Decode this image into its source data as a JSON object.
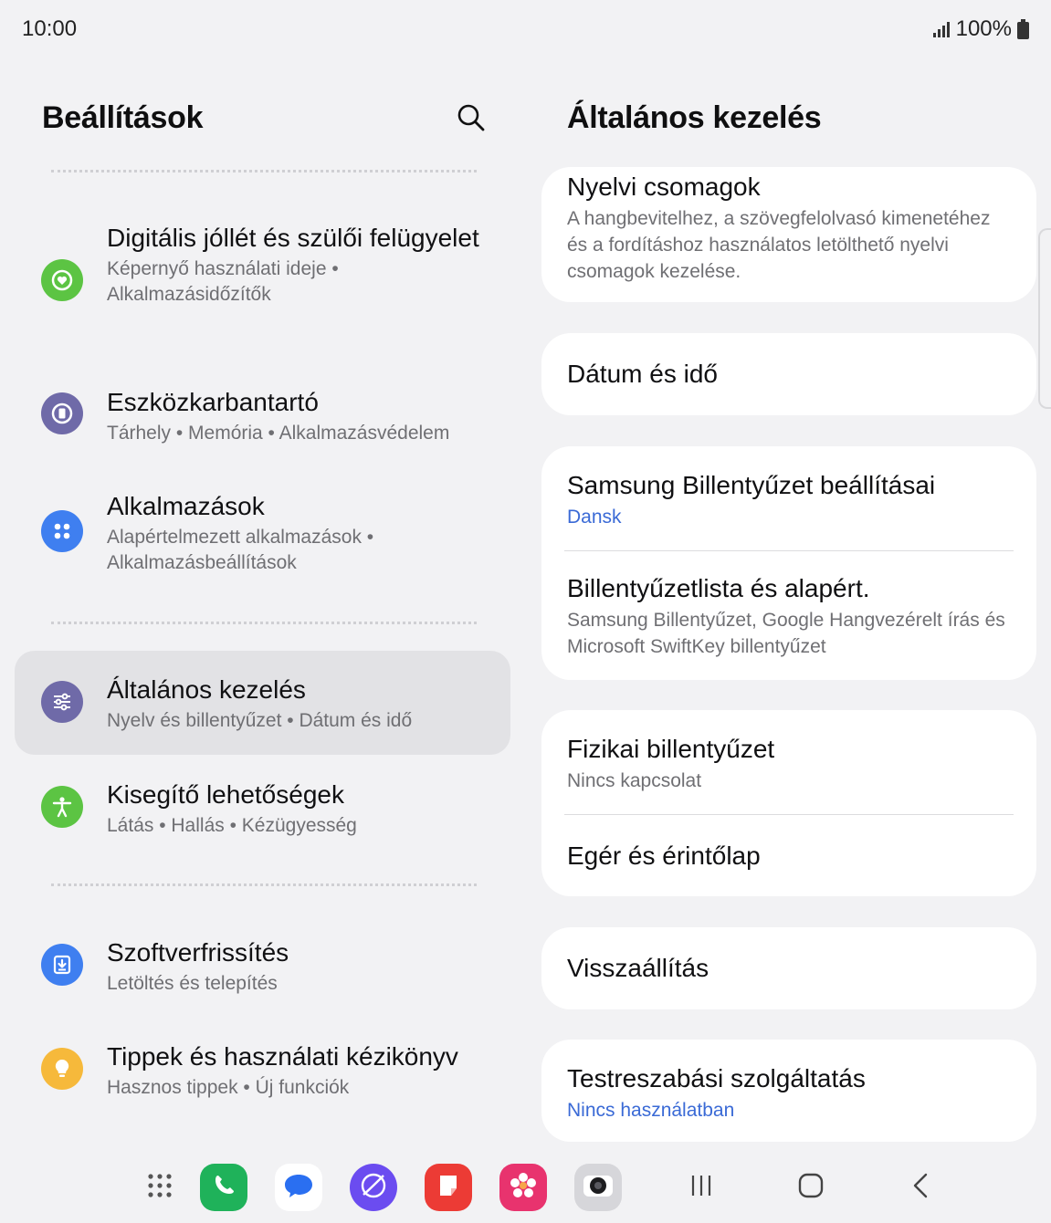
{
  "status_bar": {
    "time": "10:00",
    "battery": "100%"
  },
  "left": {
    "title": "Beállítások",
    "items": [
      {
        "title": "Digitális jóllét és szülői felügyelet",
        "subtitle": "Képernyő használati ideje  •  Alkalmazásidőzítők",
        "icon": "heart-circle-icon",
        "color": "#5cc443"
      },
      {
        "title": "Eszközkarbantartó",
        "subtitle": "Tárhely  •  Memória  •  Alkalmazásvédelem",
        "icon": "device-care-icon",
        "color": "#6f6aa8"
      },
      {
        "title": "Alkalmazások",
        "subtitle": "Alapértelmezett alkalmazások  •  Alkalmazásbeállítások",
        "icon": "apps-grid-icon",
        "color": "#3f7ff0"
      },
      {
        "title": "Általános kezelés",
        "subtitle": "Nyelv és billentyűzet  •  Dátum és idő",
        "icon": "sliders-icon",
        "color": "#6f6aa8"
      },
      {
        "title": "Kisegítő lehetőségek",
        "subtitle": "Látás  •  Hallás  •  Kézügyesség",
        "icon": "accessibility-icon",
        "color": "#5cc443"
      },
      {
        "title": "Szoftverfrissítés",
        "subtitle": "Letöltés és telepítés",
        "icon": "download-icon",
        "color": "#3f7ff0"
      },
      {
        "title": "Tippek és használati kézikönyv",
        "subtitle": "Hasznos tippek  •  Új funkciók",
        "icon": "lightbulb-icon",
        "color": "#f6b93b"
      }
    ]
  },
  "right": {
    "title": "Általános kezelés",
    "cards": [
      {
        "rows": [
          {
            "title": "Nyelvi csomagok",
            "subtitle": "A hangbevitelhez, a szövegfelolvasó kimenetéhez és a fordításhoz használatos letölthető nyelvi csomagok kezelése."
          }
        ]
      },
      {
        "rows": [
          {
            "title": "Dátum és idő"
          }
        ]
      },
      {
        "rows": [
          {
            "title": "Samsung Billentyűzet beállításai",
            "subtitle": "Dansk"
          },
          {
            "title": "Billentyűzetlista és alapért.",
            "subtitle": "Samsung Billentyűzet, Google Hangvezérelt írás és Microsoft SwiftKey billentyűzet"
          }
        ]
      },
      {
        "rows": [
          {
            "title": "Fizikai billentyűzet",
            "subtitle": "Nincs kapcsolat"
          },
          {
            "title": "Egér és érintőlap"
          }
        ]
      },
      {
        "rows": [
          {
            "title": "Visszaállítás"
          }
        ]
      },
      {
        "rows": [
          {
            "title": "Testreszabási szolgáltatás",
            "subtitle": "Nincs használatban"
          }
        ]
      }
    ]
  },
  "dock": {
    "apps": [
      "app-drawer-icon",
      "phone-icon",
      "messages-icon",
      "internet-icon",
      "notes-icon",
      "gallery-icon",
      "camera-icon"
    ],
    "nav": [
      "recents-icon",
      "home-icon",
      "back-icon"
    ]
  }
}
